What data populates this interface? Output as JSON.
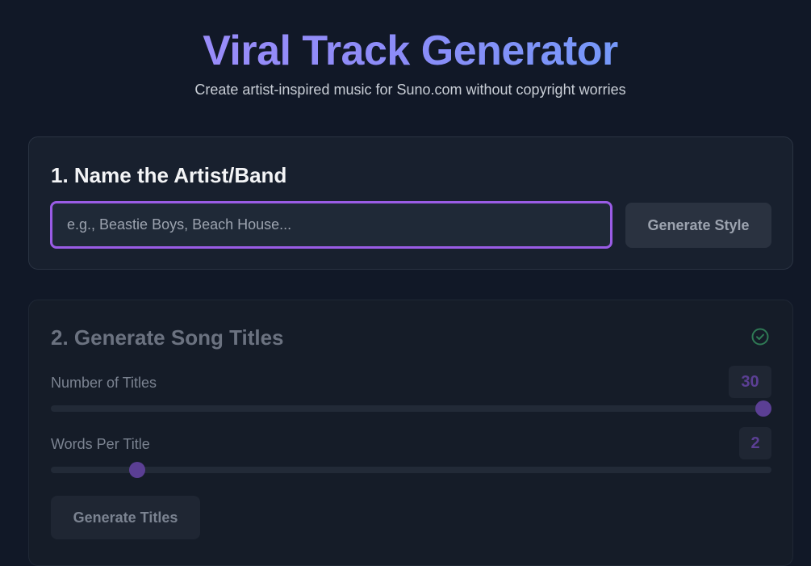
{
  "header": {
    "title": "Viral Track Generator",
    "subtitle": "Create artist-inspired music for Suno.com without copyright worries"
  },
  "step1": {
    "heading": "1. Name the Artist/Band",
    "input_placeholder": "e.g., Beastie Boys, Beach House...",
    "input_value": "",
    "button_label": "Generate Style"
  },
  "step2": {
    "heading": "2. Generate Song Titles",
    "status_icon": "check-circle-icon",
    "num_titles": {
      "label": "Number of Titles",
      "value": "30",
      "fraction": 1.0
    },
    "words_per_title": {
      "label": "Words Per Title",
      "value": "2",
      "fraction": 0.12
    },
    "button_label": "Generate Titles"
  },
  "colors": {
    "background": "#111827",
    "accent_purple": "#9a5ce6",
    "title_gradient_start": "#a78bfa",
    "title_gradient_end": "#60a5fa",
    "check_green": "#2f7a55"
  }
}
